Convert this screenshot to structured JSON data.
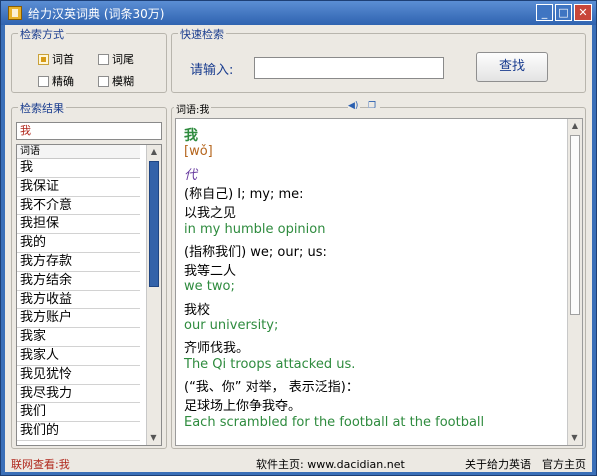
{
  "window": {
    "title": "给力汉英词典 (词条30万)",
    "buttons": [
      "_",
      "□",
      "✕"
    ]
  },
  "search_mode": {
    "legend": "检索方式",
    "options": [
      {
        "label": "词首",
        "checked": true
      },
      {
        "label": "词尾",
        "checked": false
      },
      {
        "label": "精确",
        "checked": false
      },
      {
        "label": "模糊",
        "checked": false
      }
    ]
  },
  "quick_search": {
    "legend": "快速检索",
    "label": "请输入:",
    "value": "",
    "button": "查找"
  },
  "results": {
    "legend": "检索结果",
    "query": "我",
    "column_header": "词语",
    "items": [
      "我",
      "我保证",
      "我不介意",
      "我担保",
      "我的",
      "我方存款",
      "我方结余",
      "我方收益",
      "我方账户",
      "我家",
      "我家人",
      "我见犹怜",
      "我尽我力",
      "我们",
      "我们的"
    ]
  },
  "definition": {
    "label": "词语",
    "word": "我",
    "icons": [
      "speaker-icon",
      "copy-icon"
    ],
    "lines": [
      {
        "text": "我",
        "color": "#2e8b3e",
        "bold": true
      },
      {
        "text": "[wǒ]",
        "color": "#b5651d"
      },
      {
        "text": "代",
        "color": "#6a3ea1",
        "italic": true
      },
      {
        "text": "(称自己)  I; my; me:",
        "color": "#000000"
      },
      {
        "text": " 以我之见",
        "color": "#000000"
      },
      {
        "text": "  in my humble opinion",
        "color": "#2e8b3e"
      },
      {
        "text": "(指称我们)  we; our; us:",
        "color": "#000000"
      },
      {
        "text": " 我等二人",
        "color": "#000000"
      },
      {
        "text": "  we two;",
        "color": "#2e8b3e"
      },
      {
        "text": " 我校",
        "color": "#000000"
      },
      {
        "text": "  our university;",
        "color": "#2e8b3e"
      },
      {
        "text": " 齐师伐我。",
        "color": "#000000"
      },
      {
        "text": "  The Qi troops attacked us.",
        "color": "#2e8b3e"
      },
      {
        "text": "(“我、你” 对举， 表示泛指)：",
        "color": "#000000"
      },
      {
        "text": " 足球场上你争我夺。",
        "color": "#000000"
      },
      {
        "text": "  Each scrambled for the football at the football",
        "color": "#2e8b3e"
      }
    ]
  },
  "status": {
    "left": "联网查看:我",
    "center": "软件主页: www.dacidian.net",
    "about": "关于给力英语",
    "official": "官方主页"
  }
}
